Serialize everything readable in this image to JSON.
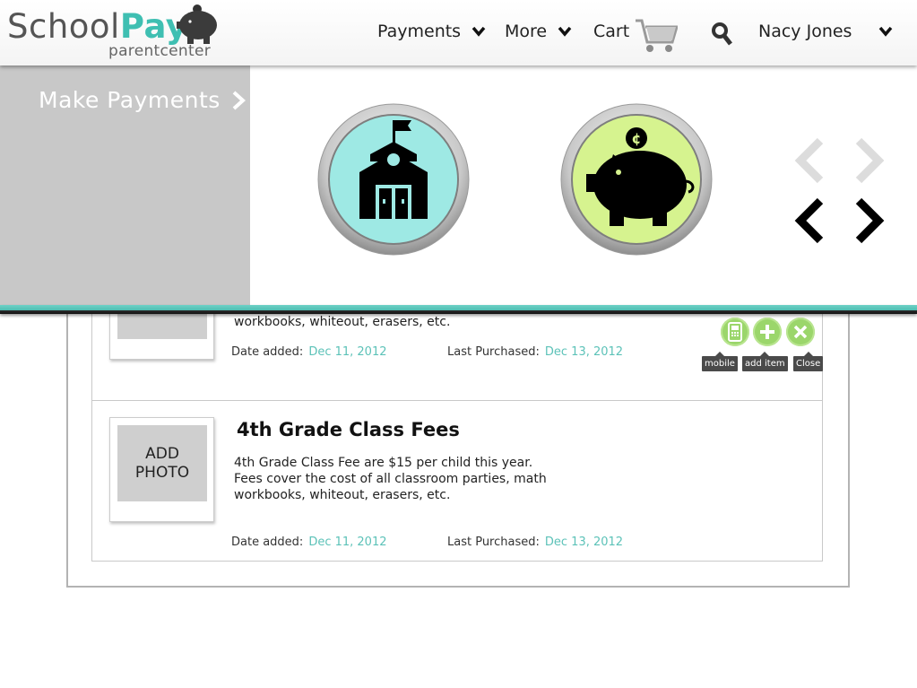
{
  "header": {
    "logo_school": "School",
    "logo_pay": "Pay",
    "logo_sub": "parentcenter",
    "nav": [
      {
        "label": "Payments",
        "icon": "chevron-down-icon"
      },
      {
        "label": "More",
        "icon": "chevron-down-icon"
      }
    ],
    "cart_label": "Cart",
    "user_name": "Nacy Jones"
  },
  "drawer": {
    "title": "Make Payments",
    "options": [
      {
        "icon": "school-building-icon",
        "color": "#9ee9e4"
      },
      {
        "icon": "piggy-bank-icon",
        "color": "#d6f38f"
      }
    ]
  },
  "items": [
    {
      "desc_visible": "workbooks, whiteout, erasers, etc.",
      "date_added_label": "Date added:",
      "date_added": "Dec 11, 2012",
      "last_purchased_label": "Last Purchased:",
      "last_purchased": "Dec 13, 2012",
      "actions": [
        {
          "icon": "mobile-icon",
          "tip": "mobile"
        },
        {
          "icon": "add-icon",
          "tip": "add item"
        },
        {
          "icon": "close-icon",
          "tip": "Close"
        }
      ]
    },
    {
      "photo_label": "ADD\nPHOTO",
      "title": "4th Grade Class Fees",
      "description": "4th Grade Class Fee are $15 per child this year.\nFees cover the cost of all classroom parties, math\nworkbooks, whiteout, erasers, etc.",
      "date_added_label": "Date added:",
      "date_added": "Dec 11, 2012",
      "last_purchased_label": "Last Purchased:",
      "last_purchased": "Dec 13, 2012"
    }
  ],
  "colors": {
    "accent": "#3fbfb2",
    "date_value": "#5cc2b8",
    "action_green": "#9bd66b"
  }
}
